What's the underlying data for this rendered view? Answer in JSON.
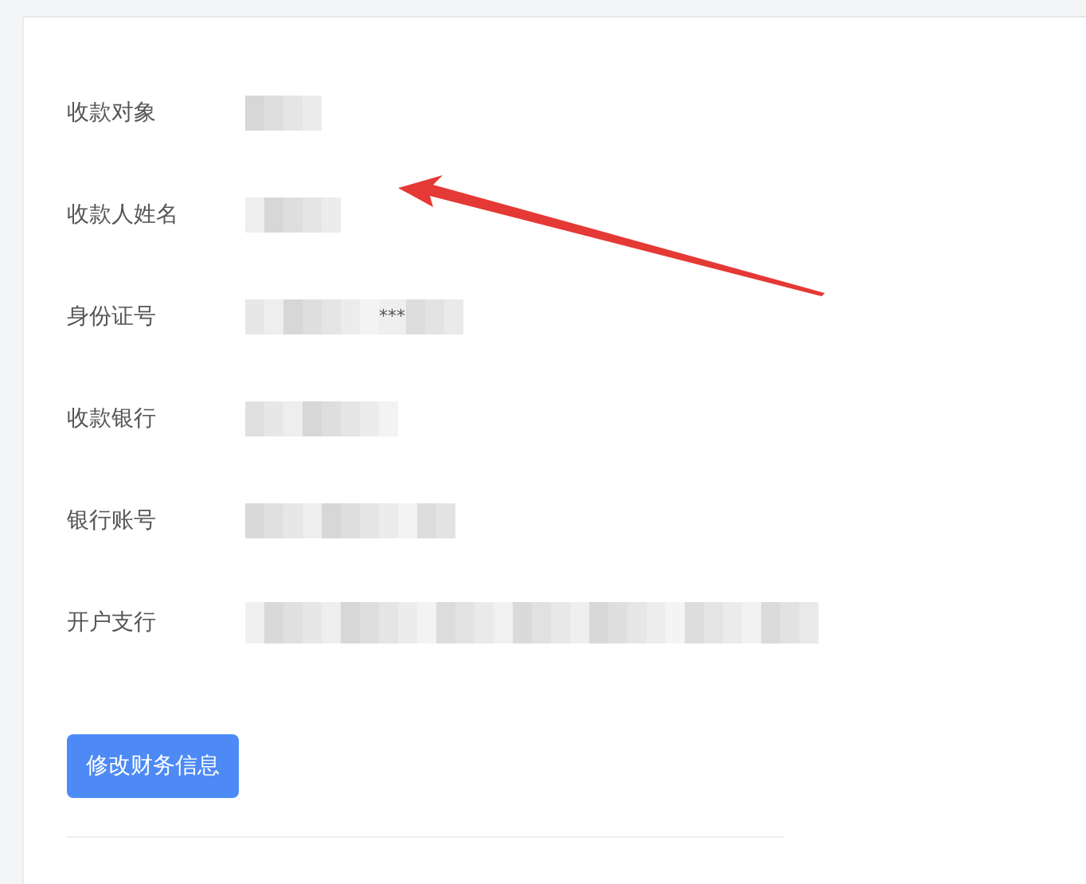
{
  "fields": [
    {
      "label": "收款对象",
      "redacted": true
    },
    {
      "label": "收款人姓名",
      "redacted": true
    },
    {
      "label": "身份证号",
      "redacted": true,
      "visible_text": "***"
    },
    {
      "label": "收款银行",
      "redacted": true
    },
    {
      "label": "银行账号",
      "redacted": true
    },
    {
      "label": "开户支行",
      "redacted": true
    }
  ],
  "button": {
    "label": "修改财务信息"
  },
  "annotation": {
    "kind": "arrow"
  }
}
